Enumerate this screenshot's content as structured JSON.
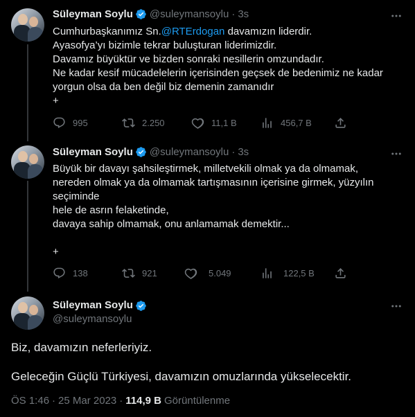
{
  "tweets": [
    {
      "author_name": "Süleyman Soylu",
      "handle": "@suleymansoylu",
      "time": "3s",
      "lines": [
        {
          "pre": "Cumhurbaşkanımız Sn.",
          "mention": "@RTErdogan",
          "post": " davamızın liderdir."
        },
        {
          "pre": "Ayasofya’yı bizimle tekrar buluşturan liderimizdir.",
          "mention": "",
          "post": ""
        },
        {
          "pre": "Davamız büyüktür ve bizden sonraki nesillerin omzundadır.",
          "mention": "",
          "post": ""
        },
        {
          "pre": "Ne kadar kesif mücadelelerin içerisinden geçsek de bedenimiz ne kadar",
          "mention": "",
          "post": ""
        },
        {
          "pre": "yorgun olsa da ben değil biz demenin zamanıdır",
          "mention": "",
          "post": ""
        },
        {
          "pre": "+",
          "mention": "",
          "post": ""
        }
      ],
      "replies": "995",
      "retweets": "2.250",
      "likes": "11,1 B",
      "views": "456,7 B"
    },
    {
      "author_name": "Süleyman Soylu",
      "handle": "@suleymansoylu",
      "time": "3s",
      "lines": [
        {
          "pre": "Büyük bir davayı şahsileştirmek, milletvekili olmak ya da olmamak,",
          "mention": "",
          "post": ""
        },
        {
          "pre": "nereden olmak ya da olmamak tartışmasının içerisine girmek, yüzyılın",
          "mention": "",
          "post": ""
        },
        {
          "pre": "seçiminde",
          "mention": "",
          "post": ""
        },
        {
          "pre": "hele de asrın felaketinde,",
          "mention": "",
          "post": ""
        },
        {
          "pre": "davaya sahip olmamak, onu anlamamak demektir...",
          "mention": "",
          "post": ""
        },
        {
          "pre": "",
          "mention": "",
          "post": ""
        },
        {
          "pre": "+",
          "mention": "",
          "post": ""
        }
      ],
      "replies": "138",
      "retweets": "921",
      "likes": "5.049",
      "views": "122,5 B"
    }
  ],
  "main_tweet": {
    "author_name": "Süleyman Soylu",
    "handle": "@suleymansoylu",
    "paragraph1": "Biz, davamızın neferleriyiz.",
    "paragraph2": "Geleceğin Güçlü Türkiyesi, davamızın omuzlarında yükselecektir.",
    "time": "ÖS 1:46",
    "date": "25 Mar 2023",
    "views_count": "114,9 B",
    "views_label": "Görüntülenme"
  },
  "icons": {
    "verified": "verified-badge-icon",
    "more": "more-icon",
    "reply": "reply-icon",
    "retweet": "retweet-icon",
    "like": "like-icon",
    "views": "views-icon",
    "share": "share-icon"
  },
  "colors": {
    "background": "#000000",
    "text": "#e7e9ea",
    "muted": "#71767b",
    "accent": "#1d9bf0",
    "thread_line": "#333639"
  }
}
